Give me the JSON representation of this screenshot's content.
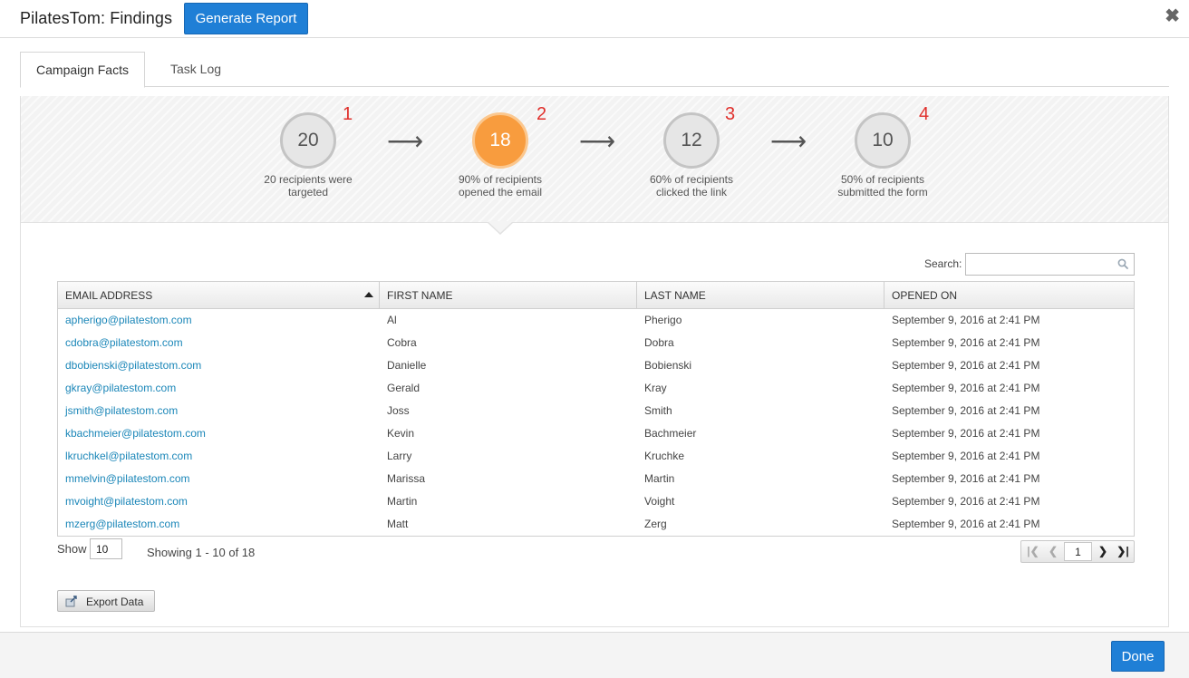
{
  "header": {
    "title": "PilatesTom: Findings",
    "generate_label": "Generate Report",
    "close_glyph": "✖"
  },
  "tabs": [
    {
      "label": "Campaign Facts",
      "active": true
    },
    {
      "label": "Task Log",
      "active": false
    }
  ],
  "funnel": {
    "steps": [
      {
        "value": "20",
        "number": "1",
        "caption_line1": "20 recipients were",
        "caption_line2": "targeted"
      },
      {
        "value": "18",
        "number": "2",
        "caption_line1": "90% of recipients",
        "caption_line2": "opened the email"
      },
      {
        "value": "12",
        "number": "3",
        "caption_line1": "60% of recipients",
        "caption_line2": "clicked the link"
      },
      {
        "value": "10",
        "number": "4",
        "caption_line1": "50% of recipients",
        "caption_line2": "submitted the form"
      }
    ],
    "arrow_glyph": "⟶",
    "active_color": "#f89c3e",
    "number_color": "#e0302c"
  },
  "search": {
    "label": "Search:",
    "value": "",
    "placeholder": ""
  },
  "table": {
    "columns": [
      "EMAIL ADDRESS",
      "FIRST NAME",
      "LAST NAME",
      "OPENED ON"
    ],
    "rows": [
      [
        "apherigo@pilatestom.com",
        "Al",
        "Pherigo",
        "September 9, 2016 at 2:41 PM"
      ],
      [
        "cdobra@pilatestom.com",
        "Cobra",
        "Dobra",
        "September 9, 2016 at 2:41 PM"
      ],
      [
        "dbobienski@pilatestom.com",
        "Danielle",
        "Bobienski",
        "September 9, 2016 at 2:41 PM"
      ],
      [
        "gkray@pilatestom.com",
        "Gerald",
        "Kray",
        "September 9, 2016 at 2:41 PM"
      ],
      [
        "jsmith@pilatestom.com",
        "Joss",
        "Smith",
        "September 9, 2016 at 2:41 PM"
      ],
      [
        "kbachmeier@pilatestom.com",
        "Kevin",
        "Bachmeier",
        "September 9, 2016 at 2:41 PM"
      ],
      [
        "lkruchkel@pilatestom.com",
        "Larry",
        "Kruchke",
        "September 9, 2016 at 2:41 PM"
      ],
      [
        "mmelvin@pilatestom.com",
        "Marissa",
        "Martin",
        "September 9, 2016 at 2:41 PM"
      ],
      [
        "mvoight@pilatestom.com",
        "Martin",
        "Voight",
        "September 9, 2016 at 2:41 PM"
      ],
      [
        "mzerg@pilatestom.com",
        "Matt",
        "Zerg",
        "September 9, 2016 at 2:41 PM"
      ]
    ],
    "link_color": "#1a86b8"
  },
  "paging": {
    "show_label": "Show",
    "page_size": "10",
    "showing_text": "Showing 1 - 10 of 18",
    "current_page": "1",
    "first_glyph": "|❮",
    "prev_glyph": "❮",
    "next_glyph": "❯",
    "last_glyph": "❯|"
  },
  "export": {
    "label": "Export Data",
    "icon": "export-icon"
  },
  "footer": {
    "done_label": "Done"
  },
  "colors": {
    "primary": "#1f7fd6"
  }
}
